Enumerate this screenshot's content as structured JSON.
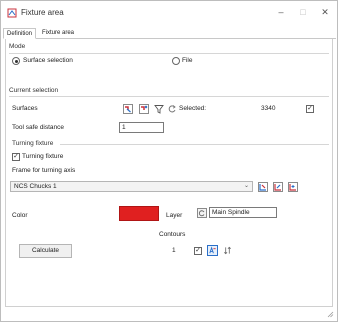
{
  "window": {
    "title": "Fixture area",
    "minimize_glyph": "–",
    "maximize_glyph": "□",
    "close_glyph": "✕"
  },
  "tabs": [
    {
      "label": "Definition",
      "active": true
    },
    {
      "label": "Fixture area",
      "active": false
    }
  ],
  "mode": {
    "group_label": "Mode",
    "options": [
      {
        "label": "Surface selection",
        "selected": true
      },
      {
        "label": "File",
        "selected": false
      }
    ]
  },
  "current_selection": {
    "group_label": "Current selection",
    "surfaces_label": "Surfaces",
    "selected_label": "Selected:",
    "selected_count": "3340",
    "selected_checked": true,
    "tool_safe_distance_label": "Tool safe distance",
    "tool_safe_distance_value": "1"
  },
  "turning_fixture": {
    "group_label": "Turning fixture",
    "checkbox_label": "Turning fixture",
    "checked": true,
    "frame_label": "Frame for turning axis",
    "frame_value": "NCS Chucks 1"
  },
  "appearance": {
    "color_label": "Color",
    "color_value": "#e02020",
    "layer_label": "Layer",
    "layer_value": "Main Spindle"
  },
  "contours": {
    "label": "Contours",
    "count": "1",
    "checked": true
  },
  "actions": {
    "calculate_label": "Calculate"
  },
  "icons": {
    "window_icon": "fixture-app-icon",
    "select_surface": "select-surface-icon",
    "deselect_surface": "deselect-surface-icon",
    "filter": "filter-icon",
    "reset": "reset-icon",
    "dropdown": "chevron-down-icon",
    "frame_pick": "frame-pick-icon",
    "frame_edit": "frame-edit-icon",
    "frame_new": "frame-new-icon",
    "layer": "layer-icon",
    "contour_show": "contour-show-icon",
    "contour_sort": "contour-sort-icon"
  },
  "colors": {
    "accent": "#2a6fc9",
    "icon_red": "#c8323c"
  }
}
